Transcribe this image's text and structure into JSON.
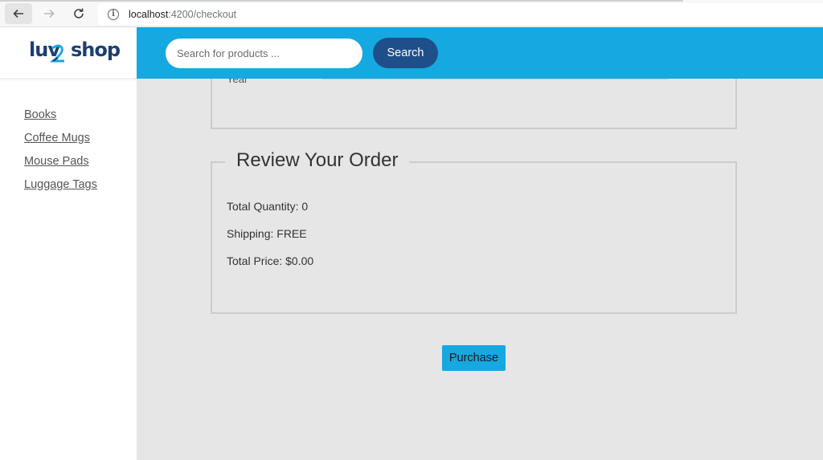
{
  "browser": {
    "url_host": "localhost",
    "url_path": ":4200/checkout"
  },
  "brand": {
    "logo_text_left": "luv",
    "logo_text_right": "shop"
  },
  "sidebar": {
    "items": [
      {
        "label": "Books"
      },
      {
        "label": "Coffee Mugs"
      },
      {
        "label": "Mouse Pads"
      },
      {
        "label": "Luggage Tags"
      }
    ]
  },
  "header": {
    "search_placeholder": "Search for products ...",
    "search_button": "Search"
  },
  "form": {
    "year_label": "Year"
  },
  "review": {
    "title": "Review Your Order",
    "total_quantity": "Total Quantity: 0",
    "shipping": "Shipping: FREE",
    "total_price": "Total Price: $0.00"
  },
  "actions": {
    "purchase_button": "Purchase"
  },
  "colors": {
    "header_bg": "#16a8e1",
    "search_button_bg": "#1f4f8a",
    "page_bg": "#e6e6e6",
    "logo": "#1c3f73"
  }
}
